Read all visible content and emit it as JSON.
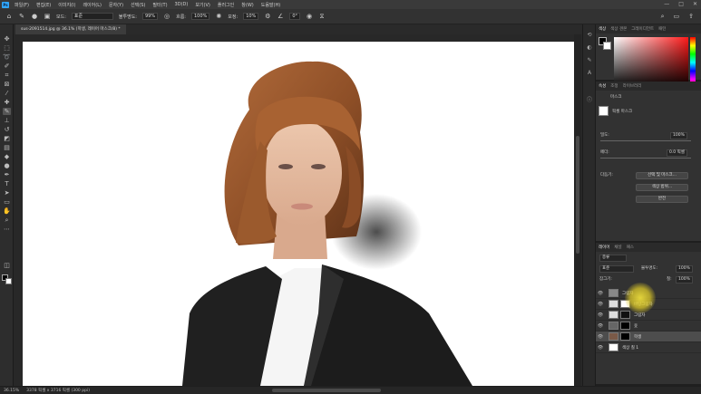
{
  "app": {
    "logo_text": "Ps",
    "menu": [
      "파일(F)",
      "편집(E)",
      "이미지(I)",
      "레이어(L)",
      "문자(Y)",
      "선택(S)",
      "필터(T)",
      "3D(D)",
      "보기(V)",
      "플러그인",
      "창(W)",
      "도움말(H)"
    ],
    "window_controls": [
      "—",
      "□",
      "✕"
    ]
  },
  "options_bar": {
    "mode_label": "모드:",
    "mode_value": "표준",
    "opacity_label": "불투명도:",
    "opacity_value": "99%",
    "flow_label": "흐름:",
    "flow_value": "100%",
    "smoothing_label": "보정:",
    "smoothing_value": "10%",
    "angle_value": "0°"
  },
  "document": {
    "tab_title": "sus-2091514.jpg @ 36.1% (학생, 레이어 마스크/8) *",
    "zoom": "36.15%",
    "size": "3378 픽셀 x 3716 픽셀 (300 ppi)"
  },
  "color_panel": {
    "tabs": [
      "색상",
      "색상 견본",
      "그레이디언트",
      "패턴"
    ],
    "hex_fg": "#000000",
    "hex_bg": "#ffffff"
  },
  "properties_panel": {
    "tabs": [
      "속성",
      "조정",
      "라이브러리"
    ],
    "header_label": "마스크",
    "mask_type": "픽셀 마스크",
    "density_label": "밀도:",
    "density_value": "100%",
    "feather_label": "페더:",
    "feather_value": "0.0 픽셀",
    "refine_label": "다듬기:",
    "buttons": [
      "선택 및 마스크...",
      "색상 범위...",
      "반전"
    ]
  },
  "layers_panel": {
    "tabs": [
      "레이어",
      "채널",
      "패스"
    ],
    "filter_label": "종류",
    "blend_mode": "표준",
    "opacity_label": "불투명도:",
    "opacity_value": "100%",
    "lock_label": "잠그기:",
    "fill_label": "칠:",
    "fill_value": "100%",
    "layers": [
      {
        "name": "그림자",
        "visible": true,
        "selected": false
      },
      {
        "name": "바탕그림자",
        "visible": true,
        "selected": false
      },
      {
        "name": "그림자",
        "visible": true,
        "selected": false
      },
      {
        "name": "옷",
        "visible": true,
        "selected": false
      },
      {
        "name": "학생",
        "visible": true,
        "selected": true
      },
      {
        "name": "색상 칠 1",
        "visible": true,
        "selected": false
      }
    ]
  },
  "colors": {
    "ps_blue": "#31a8ff",
    "hair": "#9a5a2e",
    "skin": "#e8c2a8",
    "jacket": "#1e1e1e",
    "shirt": "#f4f4f4",
    "cursor_highlight": "#e6d43a"
  }
}
